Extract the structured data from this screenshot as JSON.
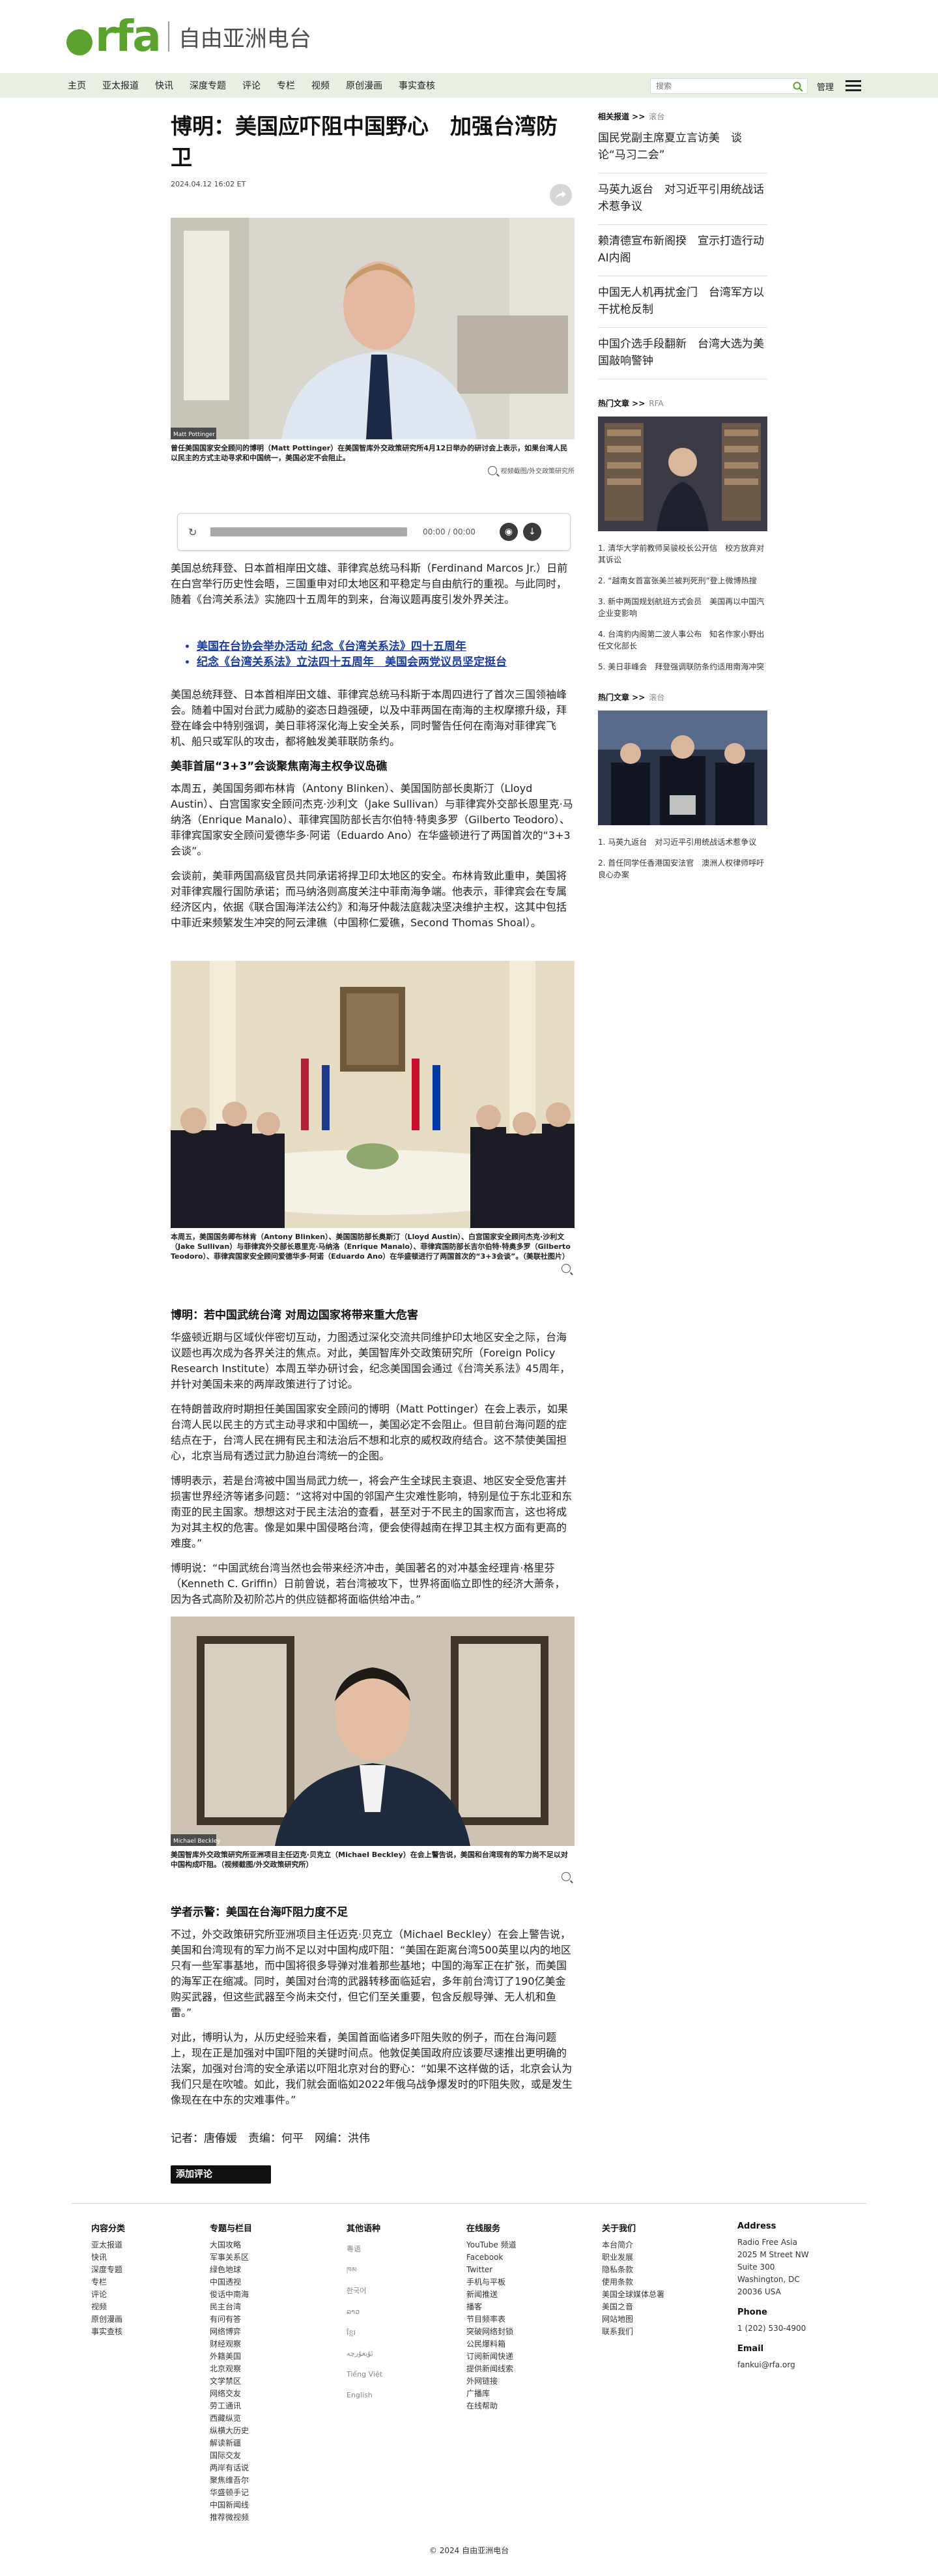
{
  "site": {
    "logo_text": "rfa",
    "name": "自由亚洲电台",
    "brand_color": "#5ba22e"
  },
  "nav": {
    "items": [
      "主页",
      "亚太报道",
      "快讯",
      "深度专题",
      "评论",
      "专栏",
      "视频",
      "原创漫画",
      "事实查核"
    ],
    "search_placeholder": "搜索",
    "manage_label": "管理"
  },
  "article": {
    "title": "博明：美国应吓阻中国野心　加强台湾防卫",
    "date": "2024.04.12 16:02 ET",
    "photo1": {
      "caption": "曾任美国国家安全顾问的博明（Matt Pottinger）在美国智库外交政策研究所4月12日举办的研讨会上表示，如果台湾人民以民主的方式主动寻求和中国统一，美国必定不会阻止。",
      "credit": "Matt Pottinger",
      "zoom_label": "视频截图/外交政策研究所"
    },
    "audio": {
      "time": "00:00 / 00:00"
    },
    "intro": "美国总统拜登、日本首相岸田文雄、菲律宾总统马科斯（Ferdinand Marcos Jr.）日前在白宫举行历史性会晤，三国重申对印太地区和平稳定与自由航行的重视。与此同时，随着《台湾关系法》实施四十五周年的到来，台海议题再度引发外界关注。",
    "links": [
      "美国在台协会举办活动 纪念《台湾关系法》四十五周年",
      "纪念《台湾关系法》立法四十五周年　美国会两党议员坚定挺台"
    ],
    "p2": "美国总统拜登、日本首相岸田文雄、菲律宾总统马科斯于本周四进行了首次三国领袖峰会。随着中国对台武力威胁的姿态日趋强硬，以及中菲两国在南海的主权摩擦升级，拜登在峰会中特别强调，美日菲将深化海上安全关系，同时警告任何在南海对菲律宾飞机、船只或军队的攻击，都将触发美菲联防条约。",
    "sub1": "美菲首届“3+3”会谈聚焦南海主权争议岛礁",
    "p3": "本周五，美国国务卿布林肯（Antony Blinken）、美国国防部长奥斯汀（Lloyd Austin）、白宫国家安全顾问杰克·沙利文（Jake Sullivan）与菲律宾外交部长恩里克·马纳洛（Enrique Manalo）、菲律宾国防部长吉尔伯特·特奥多罗（Gilberto Teodoro）、菲律宾国家安全顾问爱德华多·阿诺（Eduardo Ano）在华盛顿进行了两国首次的“3+3会谈”。",
    "p4": "会谈前，美菲两国高级官员共同承诺将捍卫印太地区的安全。布林肯致此重申，美国将对菲律宾履行国防承诺；而马纳洛则高度关注中菲南海争端。他表示，菲律宾会在专属经济区内，依据《联合国海洋法公约》和海牙仲裁法庭裁决坚决维护主权，这其中包括中菲近来频繁发生冲突的阿云津礁（中国称仁爱礁，Second Thomas Shoal）。",
    "photo2": {
      "caption": "本周五，美国国务卿布林肯（Antony Blinken）、美国国防部长奥斯汀（Lloyd Austin）、白宫国家安全顾问杰克·沙利文（Jake Sullivan）与菲律宾外交部长恩里克·马纳洛（Enrique Manalo）、菲律宾国防部长吉尔伯特·特奥多罗（Gilberto Teodoro）、菲律宾国家安全顾问爱德华多·阿诺（Eduardo Ano）在华盛顿进行了两国首次的“3+3会谈”。（美联社图片）"
    },
    "sub2": "博明：若中国武统台湾 对周边国家将带来重大危害",
    "p5": "华盛顿近期与区域伙伴密切互动，力图透过深化交流共同维护印太地区安全之际，台海议题也再次成为各界关注的焦点。对此，美国智库外交政策研究所（Foreign Policy Research Institute）本周五举办研讨会，纪念美国国会通过《台湾关系法》45周年，并针对美国未来的两岸政策进行了讨论。",
    "p6": "在特朗普政府时期担任美国国家安全顾问的博明（Matt Pottinger）在会上表示，如果台湾人民以民主的方式主动寻求和中国统一，美国必定不会阻止。但目前台海问题的症结点在于，台湾人民在拥有民主和法治后不想和北京的威权政府结合。这不禁使美国担心，北京当局有透过武力胁迫台湾统一的企图。",
    "p7": "博明表示，若是台湾被中国当局武力统一，将会产生全球民主衰退、地区安全受危害并损害世界经济等诸多问题：“这将对中国的邻国产生灾难性影响，特别是位于东北亚和东南亚的民主国家。想想这对于民主法治的查看，甚至对于不民主的国家而言，这也将成为对其主权的危害。像是如果中国侵略台湾，便会使得越南在捍卫其主权方面有更高的难度。”",
    "p8": "博明说：“中国武统台湾当然也会带来经济冲击，美国著名的对冲基金经理肯·格里芬（Kenneth C. Griffin）日前曾说，若台湾被攻下，世界将面临立即性的经济大萧条，因为各式高阶及初阶芯片的供应链都将面临供给冲击。”",
    "photo3": {
      "caption": "美国智库外交政策研究所亚洲项目主任迈克·贝克立（Michael Beckley）在会上警告说，美国和台湾现有的军力尚不足以对中国构成吓阻。（视频截图/外交政策研究所）",
      "credit": "Michael Beckley"
    },
    "sub3": "学者示警：美国在台海吓阻力度不足",
    "p9": "不过，外交政策研究所亚洲项目主任迈克·贝克立（Michael Beckley）在会上警告说，美国和台湾现有的军力尚不足以对中国构成吓阻：“美国在距离台湾500英里以内的地区只有一些军事基地，而中国将很多导弹对准着那些基地；中国的海军正在扩张，而美国的海军正在缩减。同时，美国对台湾的武器转移面临延宕，多年前台湾订了190亿美金购买武器，但这些武器至今尚未交付，但它们至关重要，包含反舰导弹、无人机和鱼雷。”",
    "p10": "对此，博明认为，从历史经验来看，美国首面临诸多吓阻失败的例子，而在台海问题上，现在正是加强对中国吓阻的关键时间点。他敦促美国政府应该要尽速推出更明确的法案，加强对台湾的安全承诺以吓阻北京对台的野心：“如果不这样做的话，北京会认为我们只是在吹嘘。如此，我们就会面临如2022年俄乌战争爆发时的吓阻失败，或是发生像现在在中东的灾难事件。”",
    "credits": "记者：唐偆媛　责编：何平　网编：洪伟",
    "comment_label": "添加评论"
  },
  "sidebar": {
    "related_head": "相关报道 >>",
    "related_src": "滚台",
    "related": [
      "国民党副主席夏立言访美　谈论“马习二会”",
      "马英九返台　对习近平引用统战话术惹争议",
      "赖清德宣布新阁揆　宣示打造行动AI内阁",
      "中国无人机再扰金门　台湾军方以干扰枪反制",
      "中国介选手段翻新　台湾大选为美国敲响警钟"
    ],
    "hot_head": "热门文章 >>",
    "hot_src": "RFA",
    "hot_list": [
      "1. 清华大学前教师吴骏校长公开信　校方放弃对其诉讼",
      "2. “越南女首富张美兰被判死刑”登上微博热搜",
      "3. 新中两国规划航班方式会员　美国再以中国汽企业变影响",
      "4. 台湾豹内阁第二波人事公布　知名作家小野出任文化部长",
      "5. 美日菲峰会　拜登强调联防条约适用南海冲突"
    ],
    "hot2_head": "热门文章 >>",
    "hot2_src": "滚台",
    "hot2_list": [
      "1. 马英九返台　对习近平引用统战话术惹争议",
      "2. 首任同学任香港国安法官　澳洲人权律师呼吁良心办案"
    ]
  },
  "footer": {
    "cols": [
      {
        "title": "内容分类",
        "items": [
          "亚太报道",
          "快讯",
          "深度专题",
          "专栏",
          "评论",
          "视频",
          "原创漫画",
          "事实查核"
        ]
      },
      {
        "title": "专题与栏目",
        "items": [
          "大国攻略",
          "军事关系区",
          "绿色地球",
          "中国透视",
          "俊话中南海",
          "民主台湾",
          "有问有答",
          "网络博弈",
          "财经观察",
          "外籍美国",
          "北京观察",
          "文学禁区",
          "网络交友",
          "劳工通讯",
          "西藏纵览",
          "纵横大历史",
          "解读新疆",
          "国际交友",
          "两岸有话说",
          "聚焦维吾尔",
          "华盛顿手记",
          "中国新闻线",
          "推荐微视频"
        ]
      },
      {
        "title": "其他语种",
        "items": [
          "粵语",
          "ཁམ",
          "한국어",
          "ລາວ",
          "ខ្មែរ",
          "ئۇيغۇرچە",
          "Tiếng Việt",
          "English"
        ]
      },
      {
        "title": "在线服务",
        "items": [
          "YouTube 频道",
          "Facebook",
          "Twitter",
          "手机与平板",
          "新闻推送",
          "播客",
          "节目频率表",
          "突破网络封锁",
          "公民爆料箱",
          "订阅新闻快递",
          "提供新闻线索",
          "外网链接",
          "广播库",
          "在线帮助"
        ]
      },
      {
        "title": "关于我们",
        "items": [
          "本台简介",
          "职业发展",
          "隐私条款",
          "使用条款",
          "美国全球媒体总署",
          "美国之音",
          "网站地图",
          "联系我们"
        ]
      },
      {
        "title": "Address",
        "items": [
          "Radio Free Asia",
          "2025 M Street NW",
          "Suite 300",
          "Washington, DC",
          "20036 USA"
        ],
        "phone_title": "Phone",
        "phone": "1 (202) 530-4900",
        "email_title": "Email",
        "email": "fankui@rfa.org"
      }
    ],
    "copyright": "© 2024 自由亚洲电台"
  }
}
